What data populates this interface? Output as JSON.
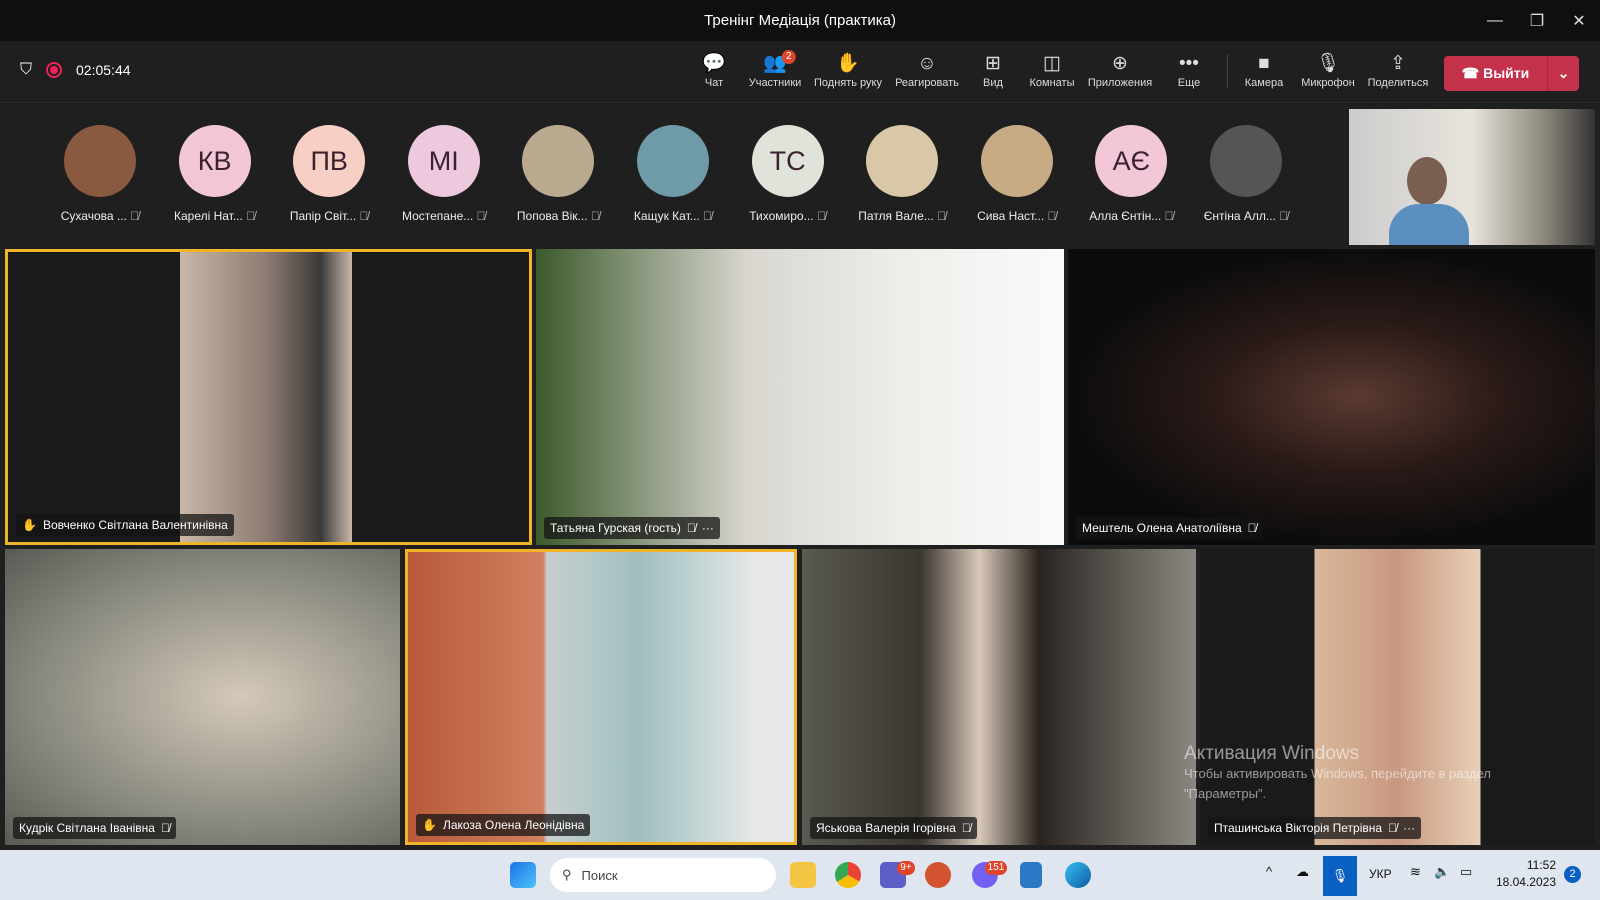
{
  "window": {
    "title": "Тренінг Медіація (практика)",
    "minimize": "—",
    "restore": "❐",
    "close": "✕"
  },
  "toolbar": {
    "timer": "02:05:44",
    "buttons": [
      {
        "label": "Чат",
        "icon": "💬"
      },
      {
        "label": "Участники",
        "icon": "👥",
        "badge": "2"
      },
      {
        "label": "Поднять руку",
        "icon": "✋"
      },
      {
        "label": "Реагировать",
        "icon": "☺"
      },
      {
        "label": "Вид",
        "icon": "⊞"
      },
      {
        "label": "Комнаты",
        "icon": "◫"
      },
      {
        "label": "Приложения",
        "icon": "⊕"
      },
      {
        "label": "Еще",
        "icon": "•••"
      },
      {
        "label": "Камера",
        "icon": "■"
      },
      {
        "label": "Микрофон",
        "icon": "🎙"
      },
      {
        "label": "Поделиться",
        "icon": "⇪"
      }
    ],
    "leave": "Выйти"
  },
  "participants": [
    {
      "name": "Сухачова ...",
      "initials": "",
      "color": "#8a5a40"
    },
    {
      "name": "Карелі Нат...",
      "initials": "КВ",
      "color": "#f3c6d6"
    },
    {
      "name": "Папір Світ...",
      "initials": "ПВ",
      "color": "#f7cfc4"
    },
    {
      "name": "Мостепане...",
      "initials": "МІ",
      "color": "#ecc9dd"
    },
    {
      "name": "Попова Вік...",
      "initials": "",
      "color": "#b9a98e"
    },
    {
      "name": "Кащук Кат...",
      "initials": "",
      "color": "#6f9aa8"
    },
    {
      "name": "Тихомиро...",
      "initials": "ТС",
      "color": "#dfe3da"
    },
    {
      "name": "Патля Вале...",
      "initials": "",
      "color": "#d9c8a8"
    },
    {
      "name": "Сива Наст...",
      "initials": "",
      "color": "#c7ab85"
    },
    {
      "name": "Алла Єнтін...",
      "initials": "АЄ",
      "color": "#f2c7d8"
    },
    {
      "name": "Єнтіна Алл...",
      "initials": "",
      "color": "#555"
    }
  ],
  "tiles": [
    {
      "name": "Вовченко Світлана Валентинівна",
      "hand": true
    },
    {
      "name": "Татьяна Гурская (гость)",
      "mic_off": true,
      "more": true
    },
    {
      "name": "Мештель Олена Анатоліївна",
      "mic_off": true
    },
    {
      "name": "Кудрік Світлана Іванівна",
      "mic_off": true
    },
    {
      "name": "Лакоза Олена Леонідівна",
      "hand": true
    },
    {
      "name": "Яськова Валерія Ігорівна",
      "mic_off": true
    },
    {
      "name": "Пташинська Вікторія Петрівна",
      "mic_off": true,
      "more": true
    }
  ],
  "watermark": {
    "title": "Активация Windows",
    "line1": "Чтобы активировать Windows, перейдите в раздел",
    "line2": "\"Параметры\"."
  },
  "taskbar": {
    "search_placeholder": "Поиск",
    "teams_badge": "9+",
    "viber_badge": "151",
    "lang": "УКР",
    "time": "11:52",
    "date": "18.04.2023",
    "notif": "2"
  }
}
